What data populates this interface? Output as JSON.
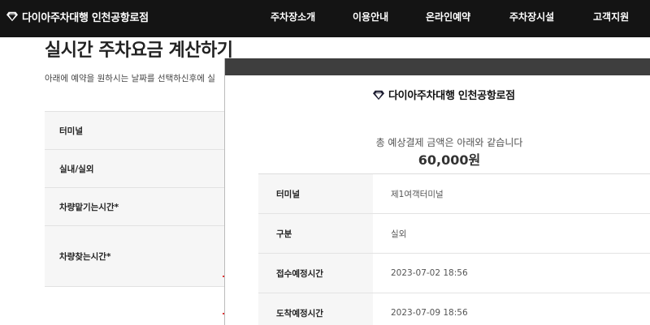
{
  "header": {
    "logo_text": "다이아주차대행 인천공항로점",
    "nav": [
      "주차장소개",
      "이용안내",
      "온라인예약",
      "주차장시설",
      "고객지원"
    ]
  },
  "page": {
    "title": "실시간 주차요금 계산하기",
    "description": "아래에 예약을 원하시는 날짜를 선택하신후에 실",
    "form_labels": [
      "터미널",
      "실내/실외",
      "차량맡기는시간*",
      "차량찾는시간*"
    ]
  },
  "modal": {
    "logo_text": "다이아주차대행 인천공항로점",
    "total_text": "총 예상결제 금액은 아래와 같습니다",
    "total_amount": "60,000원",
    "rows": [
      {
        "label": "터미널",
        "value": "제1여객터미널"
      },
      {
        "label": "구분",
        "value": "실외"
      },
      {
        "label": "접수예정시간",
        "value": "2023-07-02 18:56"
      },
      {
        "label": "도착예정시간",
        "value": "2023-07-09 18:56"
      }
    ]
  },
  "colors": {
    "topbar": "#141414",
    "modal_top": "#3e3e3e",
    "accent_red": "#dd3333"
  },
  "icons": {
    "logo": "diamond-icon"
  }
}
